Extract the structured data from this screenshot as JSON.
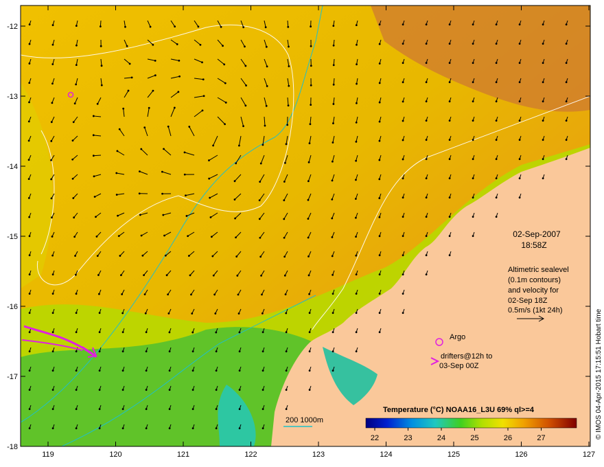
{
  "map": {
    "lon_ticks": [
      "119",
      "120",
      "121",
      "122",
      "123",
      "124",
      "125",
      "126",
      "127"
    ],
    "lat_ticks": [
      "-12",
      "-13",
      "-14",
      "-15",
      "-16",
      "-17",
      "-18"
    ]
  },
  "annotation": {
    "date": "02-Sep-2007",
    "time": "18:58Z",
    "desc": [
      "Altimetric sealevel",
      "(0.1m contours)",
      "and velocity for",
      "02-Sep 18Z",
      "0.5m/s (1kt 24h)"
    ]
  },
  "legend": {
    "argo_label": "Argo",
    "drifter_label_1": "drifters@12h to",
    "drifter_label_2": "03-Sep 00Z",
    "depth_label": "200  1000m"
  },
  "colorbar": {
    "title": "Temperature (°C) NOAA16_L3U 69% ql>=4",
    "ticks": [
      "22",
      "23",
      "24",
      "25",
      "26",
      "27"
    ]
  },
  "side_credit": "© IMOS 04-Apr-2015 17:15:51 Hobart time",
  "colors": {
    "land": "#fac89a",
    "sst_warm": "#f0a010",
    "sst_mid": "#e8c800",
    "sst_cool": "#30b030",
    "isobath": "#20c0c8",
    "drifter": "#e020e0"
  }
}
